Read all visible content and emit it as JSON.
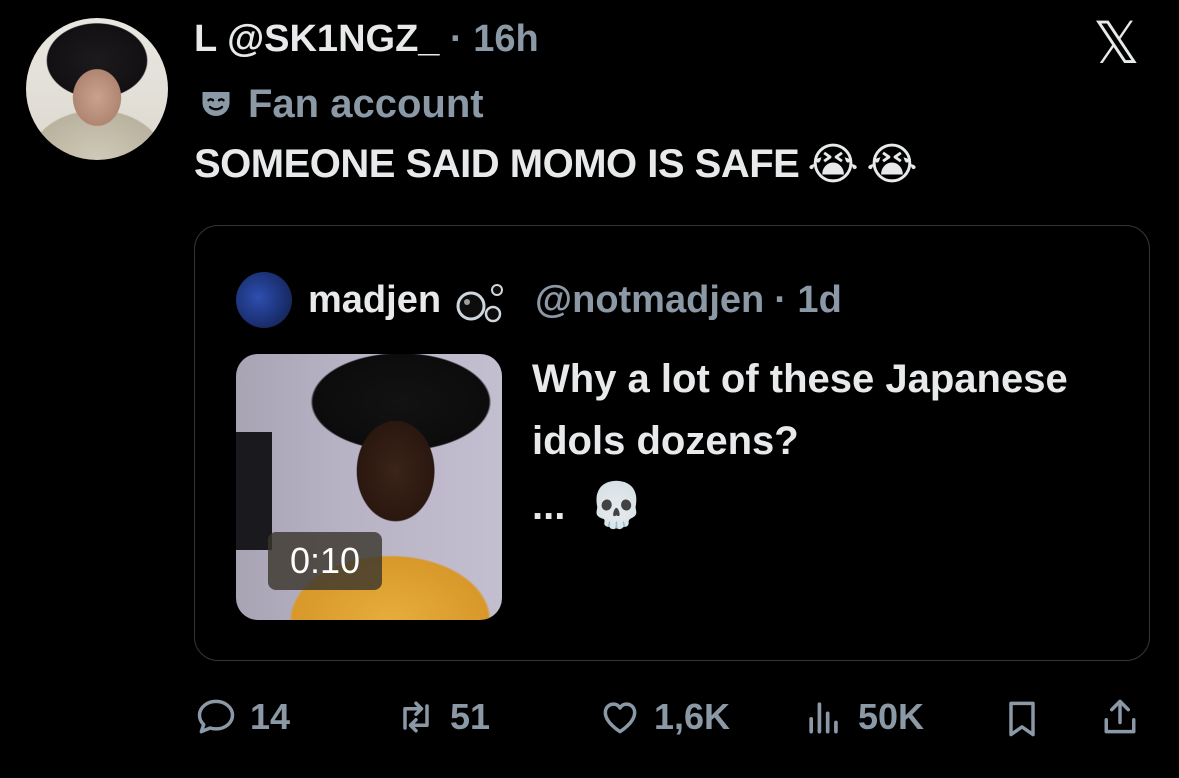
{
  "tweet": {
    "initial": "L",
    "handle": "@SK1NGZ_",
    "time": "· 16h",
    "label": "Fan account",
    "text": "SOMEONE SAID MOMO IS SAFE",
    "emoji_1": "😭",
    "emoji_2": "😭"
  },
  "quoted": {
    "name": "madjen",
    "handle": "@notmadjen",
    "time": "· 1d",
    "text": "Why a lot of these Japanese idols dozens?",
    "ellipsis": "...",
    "emoji": "💀",
    "video_duration": "0:10"
  },
  "actions": {
    "replies": "14",
    "reposts": "51",
    "likes": "1,6K",
    "views": "50K"
  },
  "icons": {
    "logo": "x-logo",
    "label": "theater-mask-icon",
    "reply": "comment-icon",
    "repost": "repost-icon",
    "like": "heart-icon",
    "views": "views-icon",
    "bookmark": "bookmark-icon",
    "share": "share-icon"
  },
  "colors": {
    "background": "#000000",
    "text": "#e7e9ea",
    "secondary": "#8b98a5",
    "border": "#333639"
  }
}
